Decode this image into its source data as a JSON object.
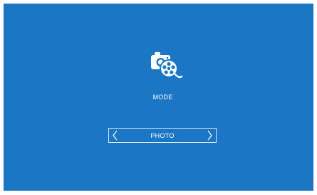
{
  "mode": {
    "icon": "camera-video-reel-icon",
    "label": "MODE"
  },
  "selector": {
    "value": "PHOTO",
    "prev_icon": "chevron-left-icon",
    "next_icon": "chevron-right-icon"
  },
  "colors": {
    "background": "#1b76c5",
    "foreground": "#ffffff"
  }
}
